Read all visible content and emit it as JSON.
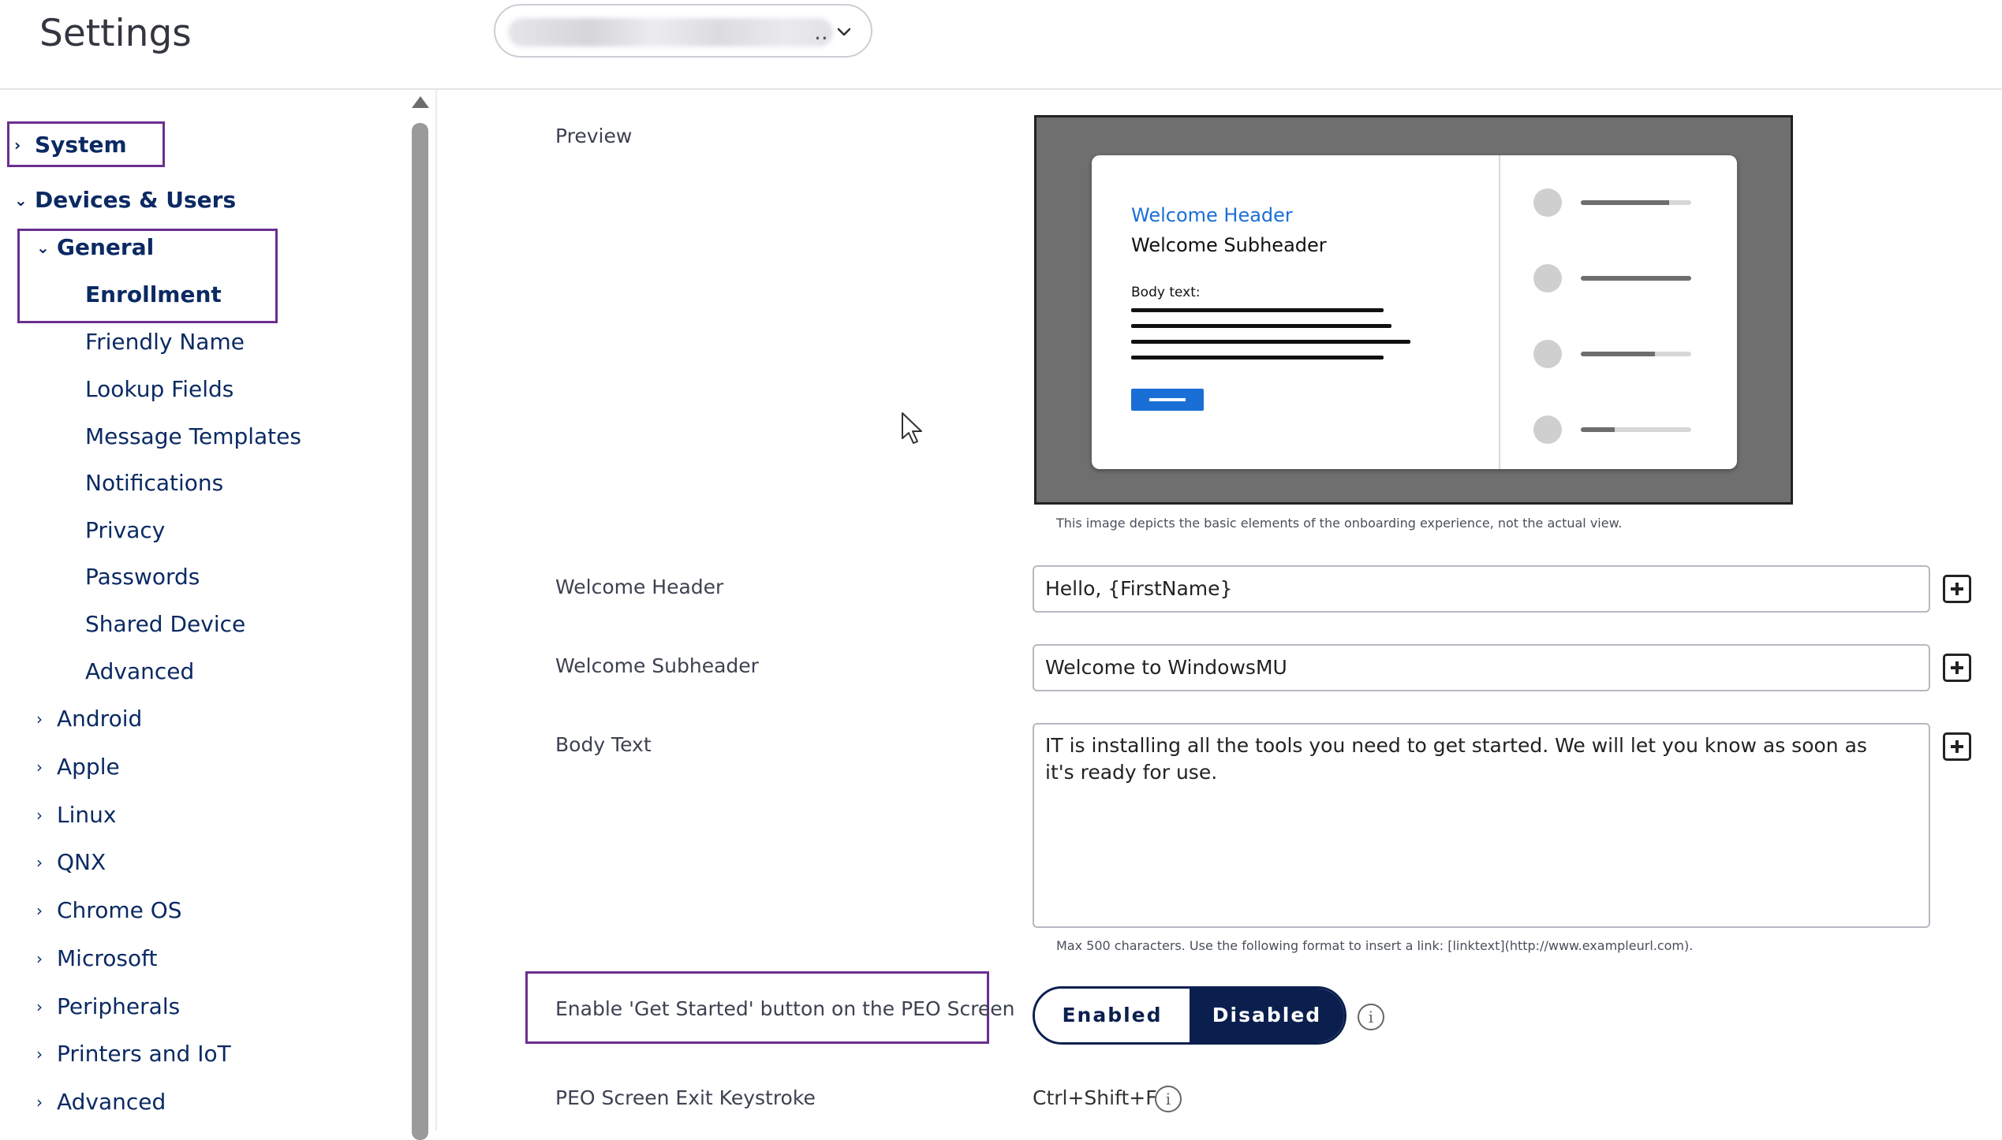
{
  "header": {
    "title": "Settings",
    "org_select": {
      "selected_suffix": "..",
      "icon": "chevron-down-icon"
    }
  },
  "sidebar": {
    "items": [
      {
        "label": "System",
        "level": 0,
        "expanded": false,
        "highlighted": true
      },
      {
        "label": "Devices & Users",
        "level": 0,
        "expanded": true
      },
      {
        "label": "General",
        "level": 1,
        "expanded": true,
        "highlighted": true
      },
      {
        "label": "Enrollment",
        "level": 2,
        "selected": true,
        "highlighted": true
      },
      {
        "label": "Friendly Name",
        "level": 2
      },
      {
        "label": "Lookup Fields",
        "level": 2
      },
      {
        "label": "Message Templates",
        "level": 2
      },
      {
        "label": "Notifications",
        "level": 2
      },
      {
        "label": "Privacy",
        "level": 2
      },
      {
        "label": "Passwords",
        "level": 2
      },
      {
        "label": "Shared Device",
        "level": 2
      },
      {
        "label": "Advanced",
        "level": 2
      },
      {
        "label": "Android",
        "level": 1,
        "expanded": false
      },
      {
        "label": "Apple",
        "level": 1,
        "expanded": false
      },
      {
        "label": "Linux",
        "level": 1,
        "expanded": false
      },
      {
        "label": "QNX",
        "level": 1,
        "expanded": false
      },
      {
        "label": "Chrome OS",
        "level": 1,
        "expanded": false
      },
      {
        "label": "Microsoft",
        "level": 1,
        "expanded": false
      },
      {
        "label": "Peripherals",
        "level": 1,
        "expanded": false
      },
      {
        "label": "Printers and IoT",
        "level": 1,
        "expanded": false
      },
      {
        "label": "Advanced",
        "level": 1,
        "expanded": false
      }
    ]
  },
  "main": {
    "preview": {
      "label": "Preview",
      "welcome_header": "Welcome Header",
      "welcome_subheader": "Welcome Subheader",
      "body_text": "Body text:",
      "caption": "This image depicts the basic elements of the onboarding experience, not the actual view.",
      "progress_levels": [
        0.8,
        1.0,
        0.67,
        0.31
      ]
    },
    "welcome_header": {
      "label": "Welcome Header",
      "value": "Hello, {FirstName}"
    },
    "welcome_subheader": {
      "label": "Welcome Subheader",
      "value": "Welcome to WindowsMU"
    },
    "body_text": {
      "label": "Body Text",
      "value": "IT is installing all the tools you need to get started. We will let you know as soon as it's ready for use.",
      "hint": "Max 500 characters. Use the following format to insert a link: [linktext](http://www.exampleurl.com)."
    },
    "get_started": {
      "label": "Enable 'Get Started' button on the PEO Screen",
      "options": [
        "Enabled",
        "Disabled"
      ],
      "selected": "Disabled"
    },
    "exit_keystroke": {
      "label": "PEO Screen Exit Keystroke",
      "value": "Ctrl+Shift+F"
    },
    "colors": {
      "accent": "#1a6fd6",
      "navy": "#0b1f4f",
      "highlight_border": "#6b2f8f",
      "nav_text": "#0b2a63"
    }
  }
}
